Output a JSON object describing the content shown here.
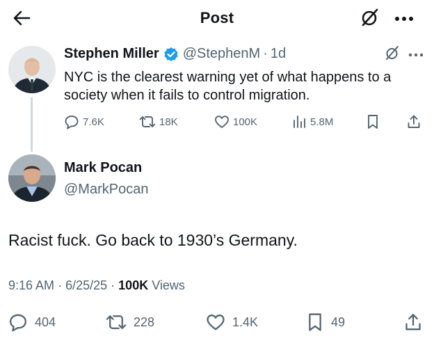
{
  "header": {
    "title": "Post",
    "back_icon": "arrow-left-icon",
    "grok_icon": "grok-icon",
    "more_icon": "more-horizontal-icon"
  },
  "parent_tweet": {
    "name": "Stephen Miller",
    "handle": "@StephenM",
    "separator": "·",
    "time": "1d",
    "text": "NYC is the clearest warning yet of what happens to a society when it fails to control migration.",
    "verified": true,
    "replies": "7.6K",
    "reposts": "18K",
    "likes": "100K",
    "views": "5.8M"
  },
  "main_tweet": {
    "name": "Mark Pocan",
    "handle": "@MarkPocan",
    "text": "Racist fuck. Go back to 1930’s Germany.",
    "time": "9:16 AM",
    "date": "6/25/25",
    "meta_sep": "·",
    "views_count": "100K",
    "views_label": "Views",
    "replies": "404",
    "reposts": "228",
    "likes": "1.4K",
    "bookmarks": "49"
  },
  "colors": {
    "text": "#0f1419",
    "secondary": "#536471",
    "verified": "#1d9bf0",
    "thread_line": "#cfd9de"
  }
}
